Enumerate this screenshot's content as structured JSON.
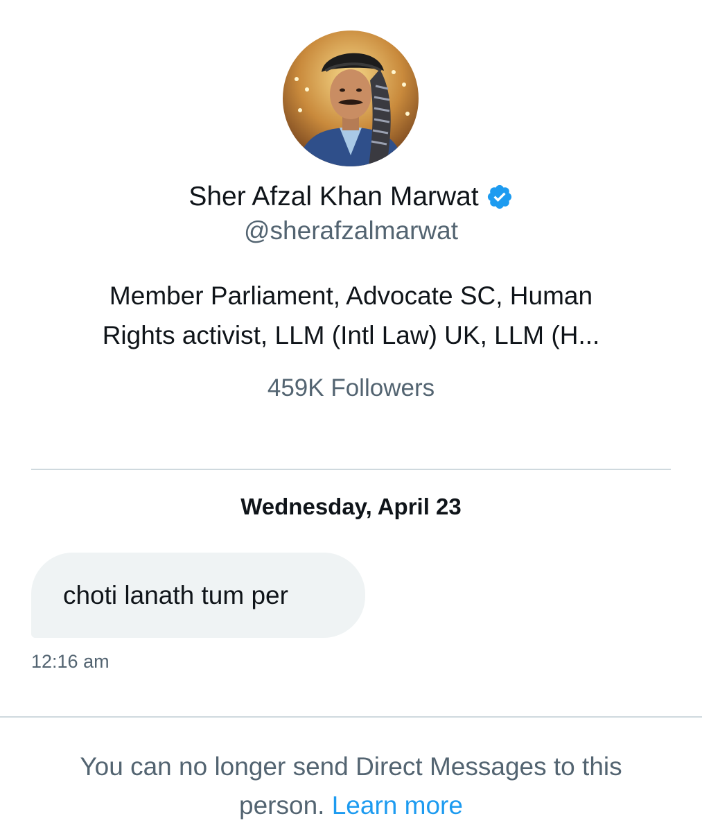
{
  "profile": {
    "name": "Sher Afzal Khan Marwat",
    "handle": "@sherafzalmarwat",
    "bio_line1": "Member Parliament, Advocate SC, Human",
    "bio_line2": "Rights activist, LLM (Intl Law) UK, LLM (H...",
    "followers": "459K Followers",
    "verified_icon": "verified-badge-icon",
    "verified_color": "#1d9bf0"
  },
  "conversation": {
    "date_header": "Wednesday, April 23",
    "messages": [
      {
        "text": "choti lanath tum per",
        "time": "12:16 am"
      }
    ]
  },
  "footer": {
    "notice_line1": "You can no longer send Direct Messages to this",
    "notice_line2_prefix": "person.",
    "learn_more": "Learn more",
    "link_color": "#1d9bf0"
  },
  "colors": {
    "primary_text": "#0f1419",
    "secondary_text": "#536471",
    "bubble_bg": "#eff3f4",
    "divider": "#cfd9de"
  }
}
